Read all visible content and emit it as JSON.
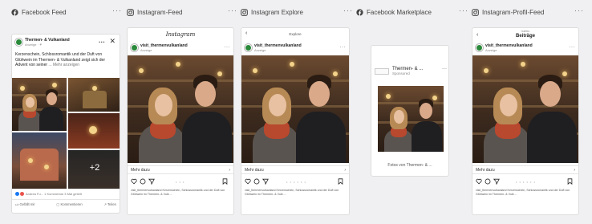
{
  "columns": [
    {
      "title": "Facebook Feed",
      "icon": "facebook-icon"
    },
    {
      "title": "Instagram-Feed",
      "icon": "instagram-icon"
    },
    {
      "title": "Instagram Explore",
      "icon": "instagram-icon"
    },
    {
      "title": "Facebook Marketplace",
      "icon": "facebook-icon"
    },
    {
      "title": "Instagram-Profil-Feed",
      "icon": "instagram-icon"
    }
  ],
  "more_label": "···",
  "facebook_feed": {
    "page_name": "Thermen- & Vulkanland",
    "sponsored": "Anzeige · ⚘",
    "text": "Kerzenschein, Schlossromantik und der Duft von Glühwein im Thermen- & Vulkanland zeigt sich der Advent von seiner",
    "more_link": "... Mehr anzeigen",
    "plus_count": "+2",
    "reactions": "Andrea Fu... 1 Kommentar 3 Mal geteilt",
    "like": "Gefällt mir",
    "comment": "Kommentieren",
    "share": "Teilen"
  },
  "instagram_feed": {
    "logo": "Instagram",
    "account": "visit_thermenvulkanland",
    "account_sub": "Anzeige",
    "cta": "Mehr dazu",
    "caption": "visit_thermenvulkanland Kerzenschein, Schlossromantik und der Duft von Glühwein im Thermen- & Vulk ..."
  },
  "instagram_explore": {
    "header": "Explore",
    "account": "visit_thermenvulkanland",
    "account_sub": "Anzeige",
    "cta": "Mehr dazu",
    "caption": "visit_thermenvulkanland Kerzenschein, Schlossromantik und der Duft von Glühwein im Thermen- & Vulk ..."
  },
  "facebook_marketplace": {
    "name": "Thermen- & ...",
    "sponsored": "Sponsored",
    "footer": "Fotos von Thermen- & ..."
  },
  "instagram_profile": {
    "header_small": "hubfeo",
    "header": "Beiträge",
    "account": "visit_thermenvulkanland",
    "account_sub": "Anzeige",
    "cta": "Mehr dazu",
    "caption": "visit_thermenvulkanland Kerzenschein, Schlossromantik und der Duft von Glühwein im Thermen- & Vulk ..."
  },
  "colors": {
    "facebook": "#1877f2",
    "instagram_avatar": "#2a8a3a",
    "background": "#f0f0f2"
  }
}
